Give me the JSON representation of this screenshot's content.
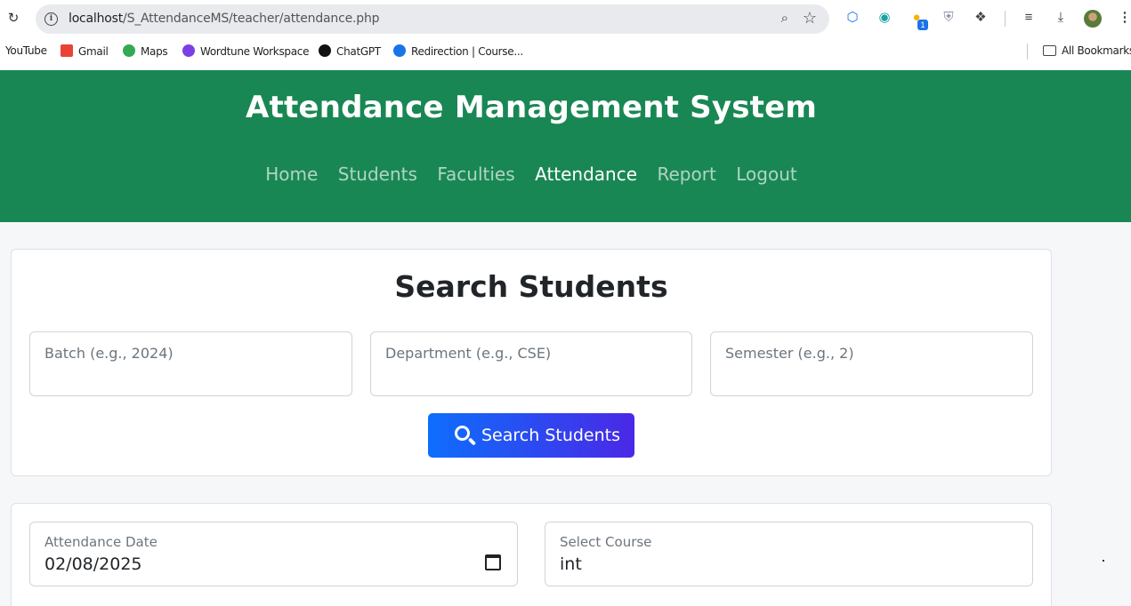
{
  "browser": {
    "url_host": "localhost",
    "url_path": "/S_AttendanceMS/teacher/attendance.php",
    "extension_badge": "1",
    "bookmarks": [
      {
        "label": "YouTube"
      },
      {
        "label": "Gmail"
      },
      {
        "label": "Maps"
      },
      {
        "label": "Wordtune Workspace"
      },
      {
        "label": "ChatGPT"
      },
      {
        "label": "Redirection | Course..."
      }
    ],
    "all_bookmarks": "All Bookmarks"
  },
  "header": {
    "title": "Attendance Management System",
    "nav": [
      "Home",
      "Students",
      "Faculties",
      "Attendance",
      "Report",
      "Logout"
    ],
    "active_nav": "Attendance"
  },
  "search_card": {
    "title": "Search Students",
    "batch_placeholder": "Batch (e.g., 2024)",
    "department_placeholder": "Department (e.g., CSE)",
    "semester_placeholder": "Semester (e.g., 2)",
    "search_button": "Search Students"
  },
  "attendance_card": {
    "date_label": "Attendance Date",
    "date_value": "02/08/2025",
    "course_label": "Select Course",
    "course_value": "int"
  },
  "colors": {
    "header_bg": "#198754",
    "button_gradient_start": "#0d6efd",
    "button_gradient_end": "#4a28e6"
  }
}
